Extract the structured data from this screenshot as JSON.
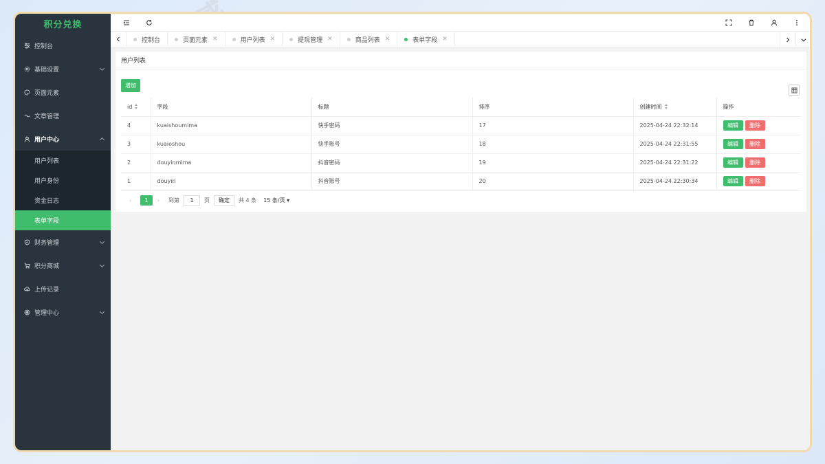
{
  "sidebar": {
    "logo": "积分兑换",
    "items": [
      {
        "label": "控制台",
        "icon": "sliders-icon",
        "has_children": false
      },
      {
        "label": "基础设置",
        "icon": "gear-icon",
        "has_children": true
      },
      {
        "label": "页面元素",
        "icon": "palette-icon",
        "has_children": false
      },
      {
        "label": "文章管理",
        "icon": "link-icon",
        "has_children": false
      },
      {
        "label": "用户中心",
        "icon": "user-icon",
        "has_children": true,
        "open": true,
        "children": [
          {
            "label": "用户列表"
          },
          {
            "label": "用户身份"
          },
          {
            "label": "资金日志"
          },
          {
            "label": "表单字段",
            "active": true
          }
        ]
      },
      {
        "label": "财务管理",
        "icon": "shield-icon",
        "has_children": true
      },
      {
        "label": "积分商城",
        "icon": "cart-icon",
        "has_children": true
      },
      {
        "label": "上传记录",
        "icon": "cloud-icon",
        "has_children": false
      },
      {
        "label": "管理中心",
        "icon": "target-icon",
        "has_children": true
      }
    ]
  },
  "topbar": {
    "left_icons": [
      "menu-fold-icon",
      "refresh-icon"
    ],
    "right_icons": [
      "fullscreen-icon",
      "trash-icon",
      "user-icon",
      "more-icon"
    ]
  },
  "tabs": [
    {
      "label": "控制台",
      "closable": false
    },
    {
      "label": "页面元素",
      "closable": true
    },
    {
      "label": "用户列表",
      "closable": true
    },
    {
      "label": "提现管理",
      "closable": true
    },
    {
      "label": "商品列表",
      "closable": true
    },
    {
      "label": "表单字段",
      "closable": true,
      "active": true
    }
  ],
  "card": {
    "title": "用户列表",
    "add_label": "增加"
  },
  "table": {
    "columns": [
      "id",
      "字段",
      "标题",
      "排序",
      "创建时间",
      "操作"
    ],
    "rows": [
      {
        "id": "4",
        "field": "kuaishoumima",
        "title": "快手密码",
        "sort": "17",
        "created": "2025-04-24 22:32:14"
      },
      {
        "id": "3",
        "field": "kuaioshou",
        "title": "快手账号",
        "sort": "18",
        "created": "2025-04-24 22:31:55"
      },
      {
        "id": "2",
        "field": "douyinmima",
        "title": "抖音密码",
        "sort": "19",
        "created": "2025-04-24 22:31:22"
      },
      {
        "id": "1",
        "field": "douyin",
        "title": "抖音账号",
        "sort": "20",
        "created": "2025-04-24 22:30:34"
      }
    ],
    "edit_label": "编辑",
    "delete_label": "删除"
  },
  "pager": {
    "current_page": "1",
    "goto_prefix": "到第",
    "goto_value": "1",
    "goto_suffix": "页",
    "confirm_label": "确定",
    "total": "共 4 条",
    "page_size": "15 条/页"
  },
  "colors": {
    "accent": "#3fbd6c",
    "danger": "#f06d6d",
    "sidebar_bg": "#2a343e",
    "frame_border": "#f3d9b0"
  },
  "watermark": "编界感"
}
